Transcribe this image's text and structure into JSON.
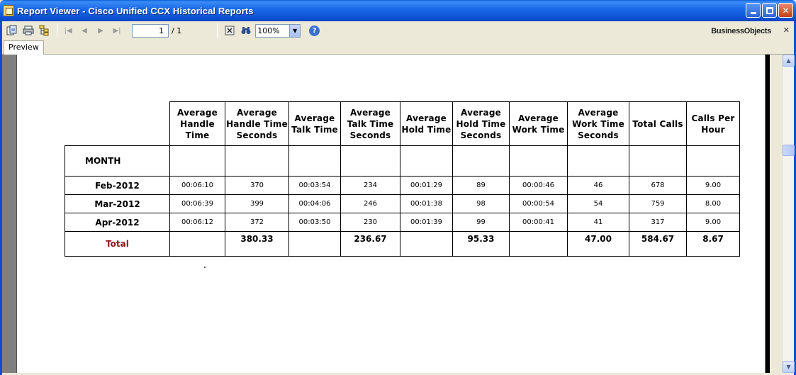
{
  "window": {
    "title": "Report Viewer - Cisco Unified CCX Historical Reports"
  },
  "toolbar": {
    "page_current": "1",
    "page_total": "/ 1",
    "zoom": "100%",
    "brand": "BusinessObjects"
  },
  "tabs": [
    {
      "label": "Preview"
    }
  ],
  "report": {
    "columns": [
      "Average Handle Time",
      "Average Handle Time Seconds",
      "Average Talk Time",
      "Average Talk Time Seconds",
      "Average Hold Time",
      "Average Hold Time Seconds",
      "Average Work Time",
      "Average Work Time Seconds",
      "Total Calls",
      "Calls Per Hour"
    ],
    "month_label": "MONTH",
    "rows": [
      {
        "month": "Feb-2012",
        "values": [
          "00:06:10",
          "370",
          "00:03:54",
          "234",
          "00:01:29",
          "89",
          "00:00:46",
          "46",
          "678",
          "9.00"
        ]
      },
      {
        "month": "Mar-2012",
        "values": [
          "00:06:39",
          "399",
          "00:04:06",
          "246",
          "00:01:38",
          "98",
          "00:00:54",
          "54",
          "759",
          "8.00"
        ]
      },
      {
        "month": "Apr-2012",
        "values": [
          "00:06:12",
          "372",
          "00:03:50",
          "230",
          "00:01:39",
          "99",
          "00:00:41",
          "41",
          "317",
          "9.00"
        ]
      }
    ],
    "total": {
      "label": "Total",
      "values": [
        "",
        "380.33",
        "",
        "236.67",
        "",
        "95.33",
        "",
        "47.00",
        "584.67",
        "8.67"
      ]
    }
  }
}
